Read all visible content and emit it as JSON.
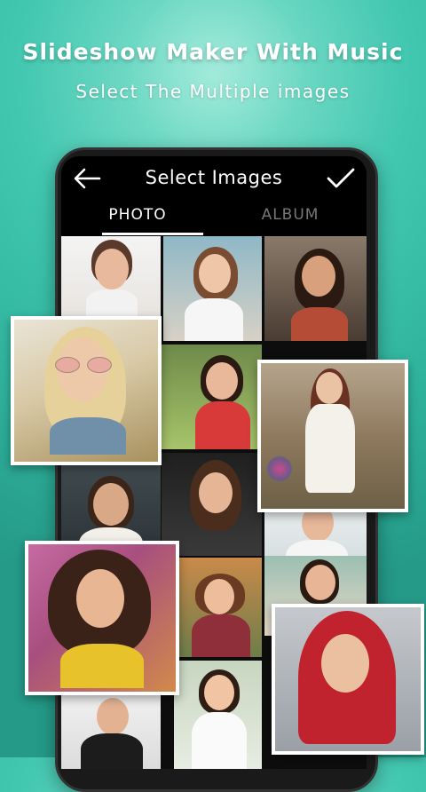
{
  "banner": {
    "title": "Slideshow Maker With Music",
    "subtitle": "Select The Multiple images"
  },
  "appbar": {
    "title": "Select Images",
    "back_icon": "arrow-left-icon",
    "confirm_icon": "checkmark-icon"
  },
  "tabs": [
    {
      "label": "PHOTO",
      "selected": true
    },
    {
      "label": "ALBUM",
      "selected": false
    }
  ],
  "colors": {
    "background": "#2fb39d",
    "appbar": "#000000",
    "tab_active": "#ffffff",
    "tab_inactive": "#777777"
  }
}
